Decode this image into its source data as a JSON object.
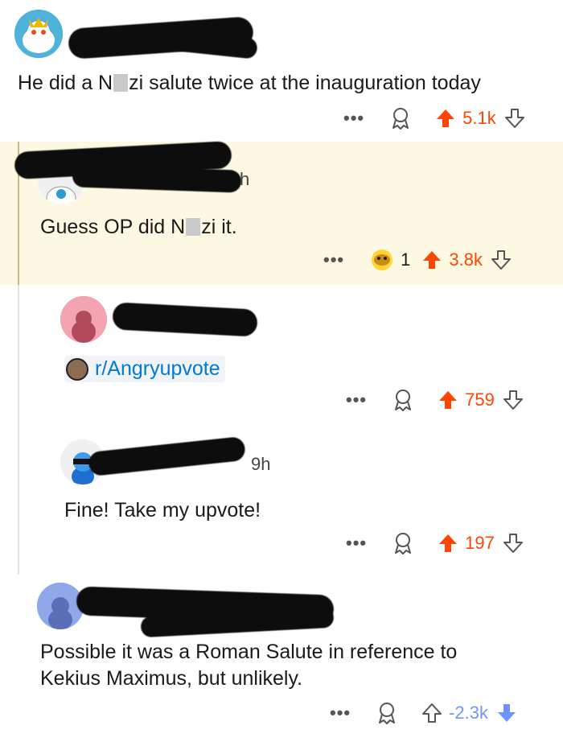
{
  "comments": [
    {
      "text_before": "He did a N",
      "text_after": "zi salute twice at the inauguration today",
      "upvotes": "5.1k",
      "vote_state": "upvoted"
    },
    {
      "time": "h",
      "text_before": "Guess OP did N",
      "text_after": "zi it.",
      "award_count": "1",
      "upvotes": "3.8k",
      "vote_state": "upvoted"
    },
    {
      "subreddit": "r/Angryupvote",
      "upvotes": "759",
      "vote_state": "upvoted"
    },
    {
      "time": "9h",
      "text": "Fine! Take my upvote!",
      "upvotes": "197",
      "vote_state": "upvoted"
    },
    {
      "text_line1": "Possible it was a Roman Salute in reference to",
      "text_line2": "Kekius Maximus, but unlikely.",
      "upvotes": "-2.3k",
      "vote_state": "downvoted"
    }
  ],
  "actions": {
    "more_label": "•••"
  },
  "colors": {
    "upvote": "#ff4500",
    "downvote": "#7193ff",
    "highlight": "#fdf8e1"
  },
  "icons": [
    "reddit-avatar-icon",
    "award-icon",
    "upvote-arrow-icon",
    "downvote-arrow-icon",
    "more-options-icon",
    "subreddit-icon"
  ]
}
